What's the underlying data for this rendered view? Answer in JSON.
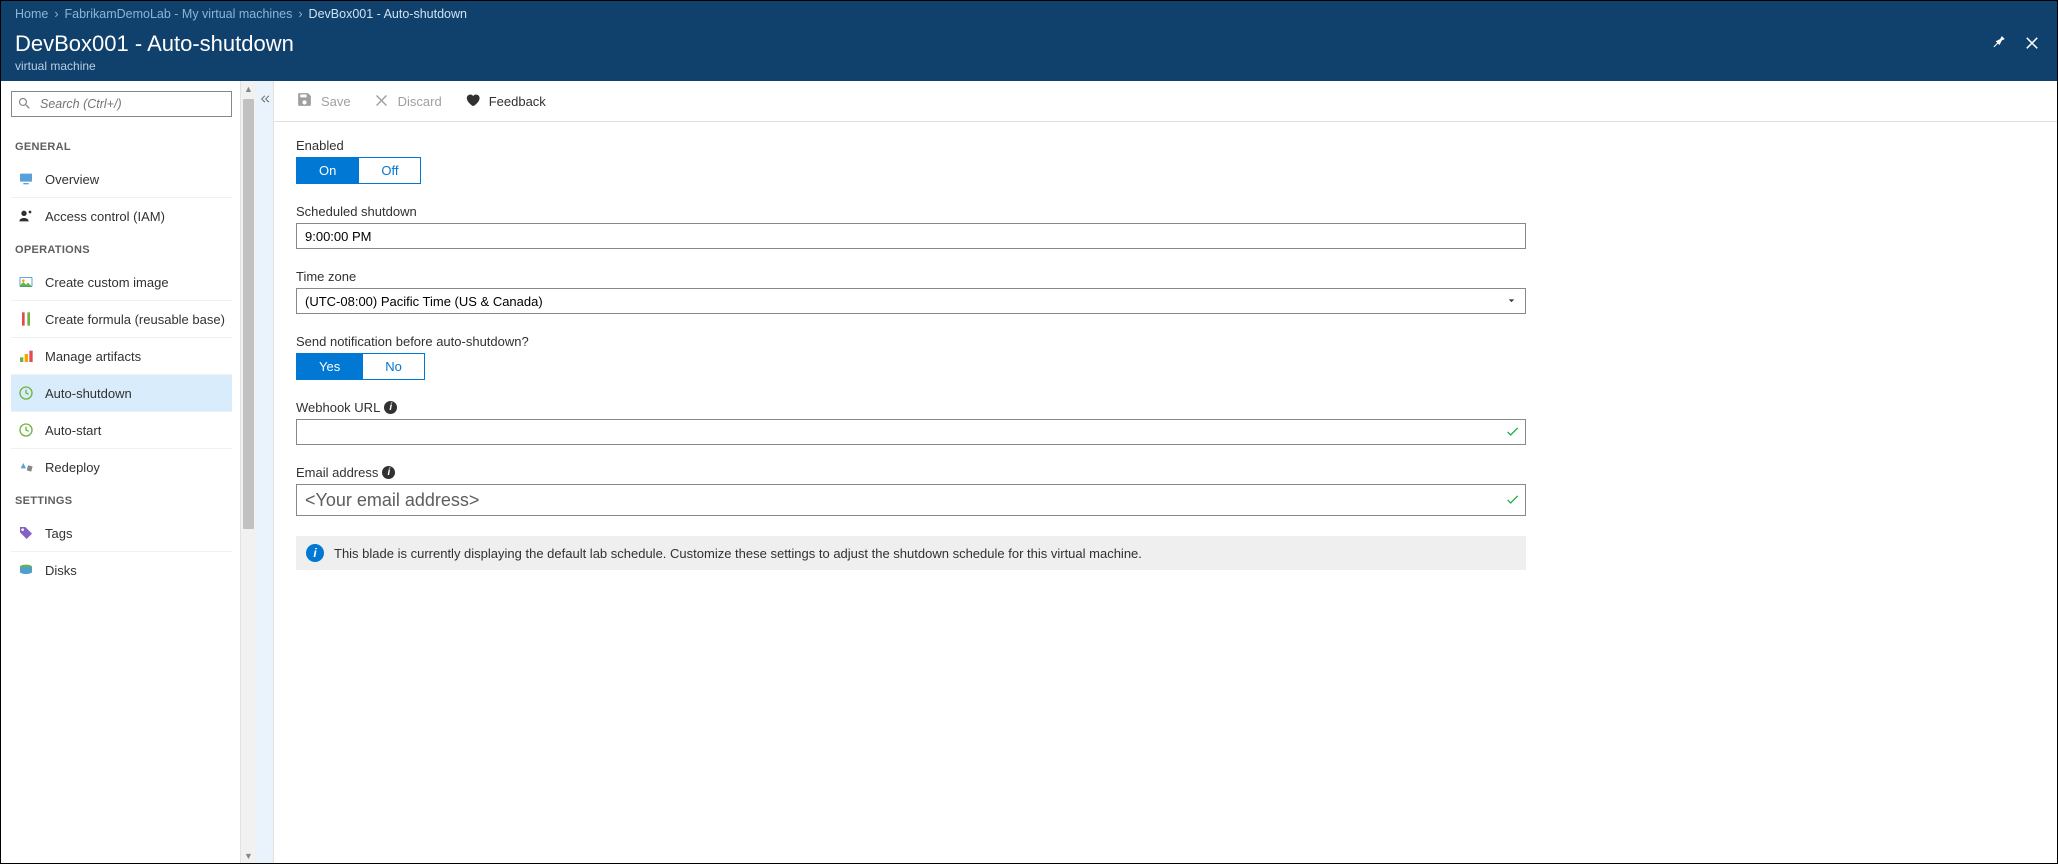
{
  "breadcrumbs": [
    {
      "label": "Home",
      "link": true
    },
    {
      "label": "FabrikamDemoLab - My virtual machines",
      "link": true
    },
    {
      "label": "DevBox001 - Auto-shutdown",
      "link": false
    }
  ],
  "page_title": "DevBox001 - Auto-shutdown",
  "page_subtitle": "virtual machine",
  "search_placeholder": "Search (Ctrl+/)",
  "sidebar": {
    "sections": [
      {
        "title": "GENERAL",
        "items": [
          {
            "label": "Overview",
            "icon": "overview",
            "selected": false
          },
          {
            "label": "Access control (IAM)",
            "icon": "iam",
            "selected": false
          }
        ]
      },
      {
        "title": "OPERATIONS",
        "items": [
          {
            "label": "Create custom image",
            "icon": "custom-image",
            "selected": false
          },
          {
            "label": "Create formula (reusable base)",
            "icon": "formula",
            "selected": false
          },
          {
            "label": "Manage artifacts",
            "icon": "artifacts",
            "selected": false
          },
          {
            "label": "Auto-shutdown",
            "icon": "clock",
            "selected": true
          },
          {
            "label": "Auto-start",
            "icon": "clock",
            "selected": false
          },
          {
            "label": "Redeploy",
            "icon": "redeploy",
            "selected": false
          }
        ]
      },
      {
        "title": "SETTINGS",
        "items": [
          {
            "label": "Tags",
            "icon": "tag",
            "selected": false
          },
          {
            "label": "Disks",
            "icon": "disks",
            "selected": false
          }
        ]
      }
    ]
  },
  "toolbar": {
    "save": "Save",
    "discard": "Discard",
    "feedback": "Feedback"
  },
  "form": {
    "enabled_label": "Enabled",
    "enabled_on": "On",
    "enabled_off": "Off",
    "scheduled_label": "Scheduled shutdown",
    "scheduled_value": "9:00:00 PM",
    "timezone_label": "Time zone",
    "timezone_value": "(UTC-08:00) Pacific Time (US & Canada)",
    "notify_label": "Send notification before auto-shutdown?",
    "notify_yes": "Yes",
    "notify_no": "No",
    "webhook_label": "Webhook URL",
    "webhook_value": "",
    "email_label": "Email address",
    "email_value": "<Your email address>"
  },
  "info_bar": "This blade is currently displaying the default lab schedule. Customize these settings to adjust the shutdown schedule for this virtual machine."
}
